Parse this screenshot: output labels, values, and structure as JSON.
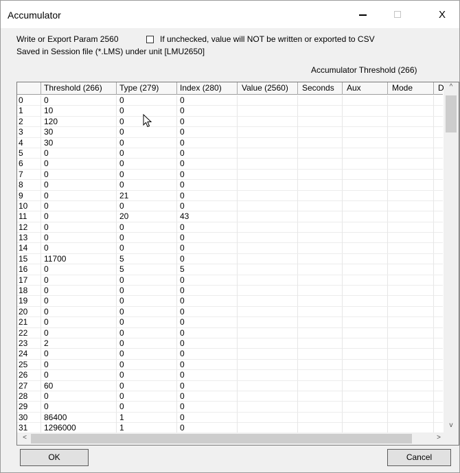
{
  "window": {
    "title": "Accumulator",
    "minimize": "–",
    "maximize": "□",
    "close": "X"
  },
  "header": {
    "write_label": "Write or Export Param 2560",
    "checkbox_label": "If unchecked, value will NOT be written or exported to CSV",
    "checkbox_checked": false,
    "session_text": "Saved in Session file (*.LMS) under unit [LMU2650]",
    "grid_title": "Accumulator Threshold (266)"
  },
  "table": {
    "columns": [
      "",
      "Threshold (266)",
      "Type (279)",
      "Index (280)",
      "Value (2560)",
      "Seconds",
      "Aux",
      "Mode",
      "D"
    ],
    "rows": [
      [
        "0",
        "0",
        "0",
        "0"
      ],
      [
        "1",
        "10",
        "0",
        "0"
      ],
      [
        "2",
        "120",
        "0",
        "0"
      ],
      [
        "3",
        "30",
        "0",
        "0"
      ],
      [
        "4",
        "30",
        "0",
        "0"
      ],
      [
        "5",
        "0",
        "0",
        "0"
      ],
      [
        "6",
        "0",
        "0",
        "0"
      ],
      [
        "7",
        "0",
        "0",
        "0"
      ],
      [
        "8",
        "0",
        "0",
        "0"
      ],
      [
        "9",
        "0",
        "21",
        "0"
      ],
      [
        "10",
        "0",
        "0",
        "0"
      ],
      [
        "11",
        "0",
        "20",
        "43"
      ],
      [
        "12",
        "0",
        "0",
        "0"
      ],
      [
        "13",
        "0",
        "0",
        "0"
      ],
      [
        "14",
        "0",
        "0",
        "0"
      ],
      [
        "15",
        "11700",
        "5",
        "0"
      ],
      [
        "16",
        "0",
        "5",
        "5"
      ],
      [
        "17",
        "0",
        "0",
        "0"
      ],
      [
        "18",
        "0",
        "0",
        "0"
      ],
      [
        "19",
        "0",
        "0",
        "0"
      ],
      [
        "20",
        "0",
        "0",
        "0"
      ],
      [
        "21",
        "0",
        "0",
        "0"
      ],
      [
        "22",
        "0",
        "0",
        "0"
      ],
      [
        "23",
        "2",
        "0",
        "0"
      ],
      [
        "24",
        "0",
        "0",
        "0"
      ],
      [
        "25",
        "0",
        "0",
        "0"
      ],
      [
        "26",
        "0",
        "0",
        "0"
      ],
      [
        "27",
        "60",
        "0",
        "0"
      ],
      [
        "28",
        "0",
        "0",
        "0"
      ],
      [
        "29",
        "0",
        "0",
        "0"
      ],
      [
        "30",
        "86400",
        "1",
        "0"
      ],
      [
        "31",
        "1296000",
        "1",
        "0"
      ]
    ]
  },
  "scroll": {
    "up": "^",
    "down": "v",
    "left": "<",
    "right": ">"
  },
  "buttons": {
    "ok": "OK",
    "cancel": "Cancel"
  }
}
